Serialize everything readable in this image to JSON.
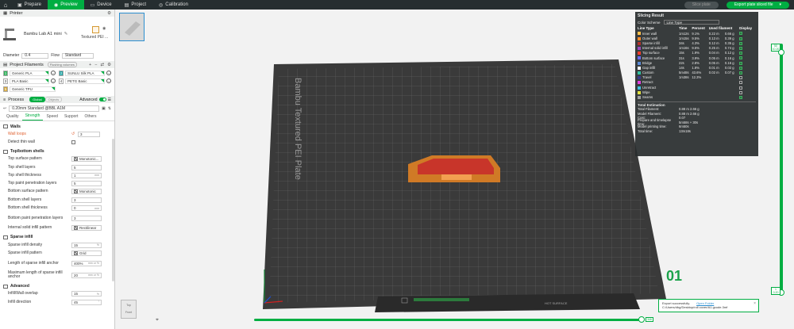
{
  "topbar": {
    "tabs": [
      {
        "label": "Prepare",
        "icon": "cube"
      },
      {
        "label": "Preview",
        "icon": "eye"
      },
      {
        "label": "Device",
        "icon": "monitor"
      },
      {
        "label": "Project",
        "icon": "folder"
      },
      {
        "label": "Calibration",
        "icon": "target"
      }
    ],
    "active_tab": "Preview",
    "slice_label": "Slice plate",
    "export_label": "Export plate sliced file",
    "accent": "#00ae42"
  },
  "printer": {
    "section_label": "Printer",
    "name": "Bambu Lab A1 mini",
    "plate_type": "Textured PEI ...",
    "diameter_label": "Diameter",
    "diameter_value": "0.4",
    "flow_label": "Flow",
    "flow_value": "Standard"
  },
  "filaments": {
    "section_label": "Project Filaments",
    "chip": "Flushing volumes",
    "items": [
      {
        "num": "1",
        "name": "Generic PLA",
        "color": "#2fb35a"
      },
      {
        "num": "2",
        "name": "SUNLU Silk PLA",
        "color": "#21a3a3"
      },
      {
        "num": "3",
        "name": "PLA Basic",
        "color": "#ffffff"
      },
      {
        "num": "4",
        "name": "PETG Basic",
        "color": "#ffffff"
      },
      {
        "num": "5",
        "name": "Generic TPU",
        "color": "#d4a63a"
      }
    ]
  },
  "process": {
    "section_label": "Process",
    "toggle_global": "Global",
    "toggle_objects": "Objects",
    "advanced_label": "Advanced",
    "preset": "0.20mm Standard @BBL A1M",
    "tabs": [
      "Quality",
      "Strength",
      "Speed",
      "Support",
      "Others"
    ],
    "active_tab": "Strength"
  },
  "settings": {
    "walls": {
      "title": "Walls",
      "wall_loops_label": "Wall loops",
      "wall_loops_value": "3",
      "detect_thin_label": "Detect thin wall"
    },
    "topbottom": {
      "title": "Top/bottom shells",
      "rows": [
        {
          "label": "Top surface pattern",
          "value": "Monotonic...",
          "pattern": true
        },
        {
          "label": "Top shell layers",
          "value": "5"
        },
        {
          "label": "Top shell thickness",
          "value": "1",
          "unit": "mm"
        },
        {
          "label": "Top paint penetration layers",
          "value": "5"
        },
        {
          "label": "Bottom surface pattern",
          "value": "Monotonic",
          "pattern": true
        },
        {
          "label": "Bottom shell layers",
          "value": "3"
        },
        {
          "label": "Bottom shell thickness",
          "value": "0",
          "unit": "mm"
        },
        {
          "label": "Bottom paint penetration layers",
          "value": "3",
          "tall": true
        },
        {
          "label": "Internal solid infill pattern",
          "value": "Rectilinear",
          "pattern": true
        }
      ]
    },
    "sparse": {
      "title": "Sparse infill",
      "rows": [
        {
          "label": "Sparse infill density",
          "value": "15",
          "unit": "%"
        },
        {
          "label": "Sparse infill pattern",
          "value": "Grid",
          "pattern": true
        },
        {
          "label": "Length of sparse infill anchor",
          "value": "400%",
          "unit": "mm or %",
          "tall": true
        },
        {
          "label": "Maximum length of sparse infill anchor",
          "value": "20",
          "unit": "mm or %",
          "tall": true
        }
      ]
    },
    "advanced": {
      "title": "Advanced",
      "rows": [
        {
          "label": "Infill/Wall overlap",
          "value": "15",
          "unit": "%"
        },
        {
          "label": "Infill direction",
          "value": "45",
          "unit": "°"
        }
      ]
    }
  },
  "viewport": {
    "plate_text": "Bambu Textured PEI Plate",
    "plate_number": "01",
    "brand_text": "HOT SURFACE",
    "cube_top": "Top",
    "cube_front": "Front"
  },
  "slicing_result": {
    "title": "Slicing Result",
    "color_scheme_label": "Color Scheme",
    "color_scheme_value": "Line Type",
    "headers": [
      "Line Type",
      "Time",
      "Percent",
      "Used filament",
      "Display"
    ],
    "rows": [
      {
        "type": "Inner wall",
        "color": "#ffc04a",
        "time": "1m12s",
        "percent": "9.1%",
        "used": "0.22 m",
        "grams": "0.66 g",
        "display": true
      },
      {
        "type": "Outer wall",
        "color": "#ff8a2a",
        "time": "1m15s",
        "percent": "9.5%",
        "used": "0.13 m",
        "grams": "0.39 g",
        "display": true
      },
      {
        "type": "Sparse infill",
        "color": "#b03029",
        "time": "34s",
        "percent": "4.3%",
        "used": "0.12 m",
        "grams": "0.35 g",
        "display": true
      },
      {
        "type": "Internal solid infill",
        "color": "#9a4bbf",
        "time": "1m16s",
        "percent": "9.5%",
        "used": "0.25 m",
        "grams": "0.74 g",
        "display": true
      },
      {
        "type": "Top surface",
        "color": "#ff3a2a",
        "time": "15s",
        "percent": "1.9%",
        "used": "0.04 m",
        "grams": "0.12 g",
        "display": true
      },
      {
        "type": "Bottom surface",
        "color": "#6a6aff",
        "time": "31s",
        "percent": "3.9%",
        "used": "0.05 m",
        "grams": "0.16 g",
        "display": true
      },
      {
        "type": "Bridge",
        "color": "#5a8ad8",
        "time": "22s",
        "percent": "2.8%",
        "used": "0.05 m",
        "grams": "0.16 g",
        "display": true
      },
      {
        "type": "Gap infill",
        "color": "#ffffff",
        "time": "14s",
        "percent": "1.8%",
        "used": "0.01 m",
        "grams": "0.02 g",
        "display": true
      },
      {
        "type": "Custom",
        "color": "#30c0a0",
        "time": "5m48s",
        "percent": "43.6%",
        "used": "0.02 m",
        "grams": "0.07 g",
        "display": true
      },
      {
        "type": "Travel",
        "color": "#3a3a8a",
        "time": "1m38s",
        "percent": "12.3%",
        "used": "",
        "grams": "",
        "display": false
      },
      {
        "type": "Retract",
        "color": "#e040e0",
        "time": "",
        "percent": "",
        "used": "",
        "grams": "",
        "display": false
      },
      {
        "type": "Unretract",
        "color": "#40c0e0",
        "time": "",
        "percent": "",
        "used": "",
        "grams": "",
        "display": false
      },
      {
        "type": "Wipe",
        "color": "#e0e040",
        "time": "",
        "percent": "",
        "used": "",
        "grams": "",
        "display": false
      },
      {
        "type": "Seams",
        "color": "#a0a0a0",
        "time": "",
        "percent": "",
        "used": "",
        "grams": "",
        "display": true
      }
    ],
    "estimation_title": "Total Estimation",
    "estimation": [
      {
        "k": "Total Filament:",
        "v": "0.88 m   2.66 g"
      },
      {
        "k": "Model Filament:",
        "v": "0.88 m   2.66 g"
      },
      {
        "k": "Cost:",
        "v": "0.07"
      },
      {
        "k": "Prepare and timelapse time:",
        "v": "5m58s + 30s"
      },
      {
        "k": "Model printing time:",
        "v": "6m50s"
      },
      {
        "k": "Total time:",
        "v": "13m18s"
      }
    ]
  },
  "layer_slider": {
    "top_layer": "50",
    "top_height": "10.20",
    "bottom_layer": "1",
    "bottom_height": "0.20"
  },
  "move_slider": {
    "value": "346"
  },
  "toast": {
    "message": "Export successfully.",
    "link": "Open Folder",
    "path": "C:/Users/dbg/Desktop/roll cover/A1.gcode.3mf"
  }
}
